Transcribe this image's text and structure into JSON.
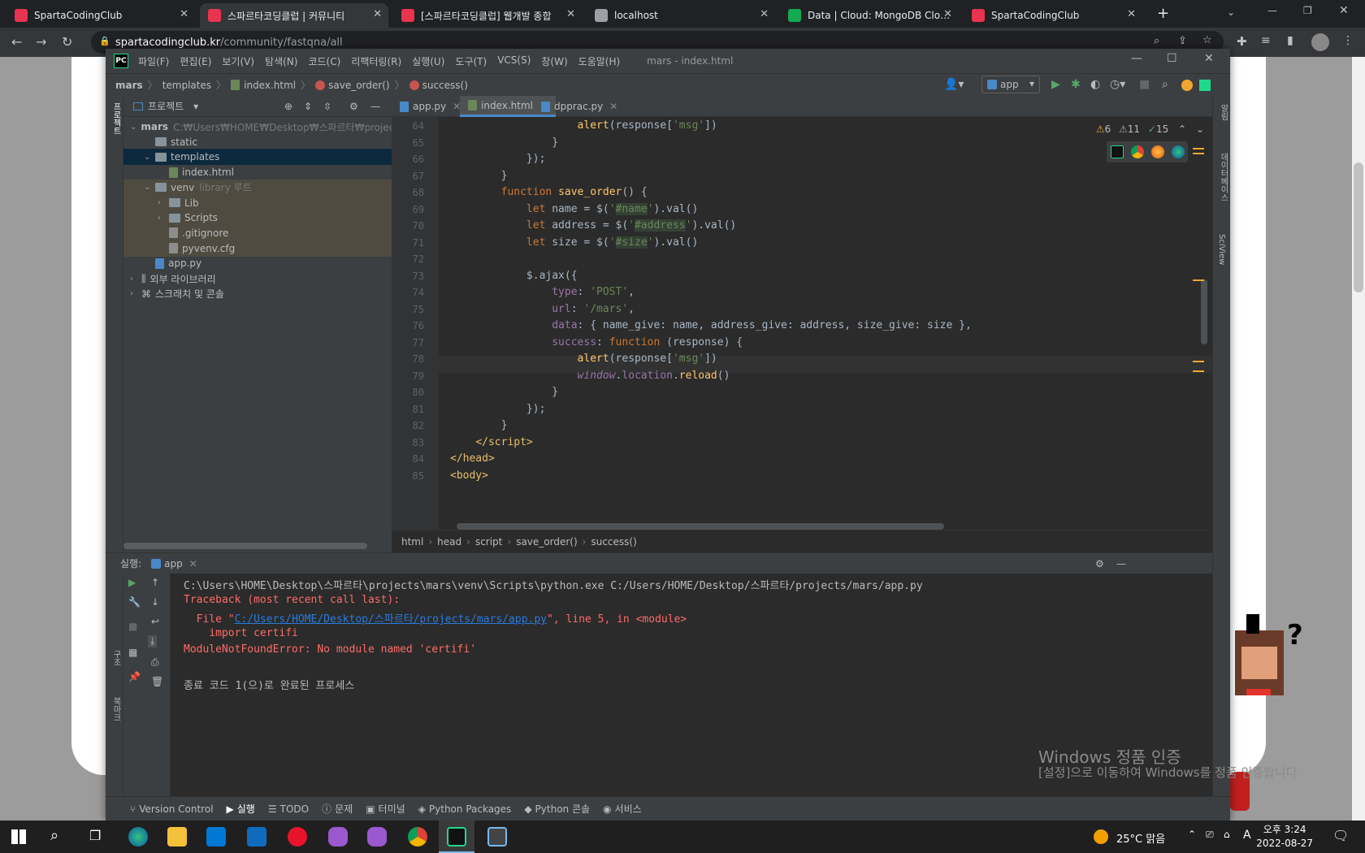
{
  "browser": {
    "tabs": [
      {
        "title": "SpartaCodingClub",
        "icon": "sparta-icon",
        "color": "#e8344e"
      },
      {
        "title": "스파르타코딩클럽 | 커뮤니티",
        "icon": "heart-icon",
        "color": "#e8344e"
      },
      {
        "title": "[스파르타코딩클럽] 웹개발 종합",
        "icon": "question-icon",
        "color": "#e8344e"
      },
      {
        "title": "localhost",
        "icon": "globe-icon",
        "color": "#9aa0a6"
      },
      {
        "title": "Data | Cloud: MongoDB Cloud",
        "icon": "mongodb-leaf-icon",
        "color": "#13aa52"
      },
      {
        "title": "SpartaCodingClub",
        "icon": "sparta-icon",
        "color": "#e8344e"
      }
    ],
    "url_domain": "spartacodingclub.kr",
    "url_path": "/community/fastqna/all"
  },
  "ide": {
    "window_title": "mars - index.html",
    "menus": [
      "파일(F)",
      "편집(E)",
      "보기(V)",
      "탐색(N)",
      "코드(C)",
      "리팩터링(R)",
      "실행(U)",
      "도구(T)",
      "VCS(S)",
      "창(W)",
      "도움말(H)"
    ],
    "breadcrumbs": [
      "mars",
      "templates",
      "index.html",
      "save_order()",
      "success()"
    ],
    "run_config": "app",
    "left_strip_label": "프로젝트",
    "left_strip_bottom": [
      "구조",
      "북마크"
    ],
    "right_strip_labels": [
      "알림",
      "데이터베이스",
      "SciView"
    ],
    "project_panel_title": "프로젝트",
    "tree": [
      {
        "label": "mars",
        "extra": "C:₩Users₩HOME₩Desktop₩스파르타₩projects₩mars",
        "kind": "folder",
        "indent": 0,
        "arrow": "v"
      },
      {
        "label": "static",
        "kind": "folder",
        "indent": 1,
        "arrow": ""
      },
      {
        "label": "templates",
        "kind": "folder",
        "indent": 1,
        "arrow": "v"
      },
      {
        "label": "index.html",
        "kind": "html",
        "indent": 2,
        "arrow": ""
      },
      {
        "label": "venv",
        "extra": "library 루트",
        "kind": "folder",
        "indent": 1,
        "arrow": "v"
      },
      {
        "label": "Lib",
        "kind": "folder",
        "indent": 2,
        "arrow": ">"
      },
      {
        "label": "Scripts",
        "kind": "folder",
        "indent": 2,
        "arrow": ">"
      },
      {
        "label": ".gitignore",
        "kind": "txt",
        "indent": 2,
        "arrow": ""
      },
      {
        "label": "pyvenv.cfg",
        "kind": "txt",
        "indent": 2,
        "arrow": ""
      },
      {
        "label": "app.py",
        "kind": "py",
        "indent": 1,
        "arrow": ""
      },
      {
        "label": "외부 라이브러리",
        "kind": "lib",
        "indent": 0,
        "arrow": ">"
      },
      {
        "label": "스크래치 및 콘솔",
        "kind": "scratch",
        "indent": 0,
        "arrow": ">"
      }
    ],
    "editor_tabs": [
      "app.py",
      "index.html",
      "dpprac.py"
    ],
    "inspections": {
      "warn_a": "6",
      "warn_b": "11",
      "ok": "15"
    },
    "lines": [
      {
        "n": "64",
        "html": "            <span class=\"fn\">alert</span>(response[<span class=\"str\">'msg'</span>])"
      },
      {
        "n": "65",
        "html": "        }"
      },
      {
        "n": "66",
        "html": "    });"
      },
      {
        "n": "67",
        "html": "}"
      },
      {
        "n": "68",
        "html": "<span class=\"kw\">function</span> <span class=\"fn\">save_order</span>() {"
      },
      {
        "n": "69",
        "html": "    <span class=\"kw\">let</span> name = $(<span class=\"str\">'<span class=\"hl\">#name</span>'</span>).val()"
      },
      {
        "n": "70",
        "html": "    <span class=\"kw\">let</span> address = $(<span class=\"str\">'<span class=\"hl\">#address</span>'</span>).val()"
      },
      {
        "n": "71",
        "html": "    <span class=\"kw\">let</span> size = $(<span class=\"str\">'<span class=\"hl\">#size</span>'</span>).val()"
      },
      {
        "n": "72",
        "html": ""
      },
      {
        "n": "73",
        "html": "    $.ajax({"
      },
      {
        "n": "74",
        "html": "        <span class=\"prop\">type</span>: <span class=\"str\">'POST'</span>,"
      },
      {
        "n": "75",
        "html": "        <span class=\"prop\">url</span>: <span class=\"str\">'/mars'</span>,"
      },
      {
        "n": "76",
        "html": "        <span class=\"prop\">data</span>: { name_give: name, address_give: address, size_give: size },"
      },
      {
        "n": "77",
        "html": "        <span class=\"prop\">success</span>: <span class=\"kw\">function</span> (response) {"
      },
      {
        "n": "78",
        "html": "            <span class=\"fn\">alert</span>(response[<span class=\"str\">'msg'</span>])"
      },
      {
        "n": "79",
        "html": "            <span class=\"ital\">window</span>.<span class=\"prop\">location</span>.<span class=\"fn\">reload</span>()"
      },
      {
        "n": "80",
        "html": "        }"
      },
      {
        "n": "81",
        "html": "    });"
      },
      {
        "n": "82",
        "html": "}"
      },
      {
        "n": "83",
        "html": "<span class=\"tag\">&lt;/script&gt;</span>"
      },
      {
        "n": "84",
        "html": "<span class=\"tag\">&lt;/head&gt;</span>"
      },
      {
        "n": "85",
        "html": "<span class=\"tag\">&lt;body&gt;</span>"
      }
    ],
    "editor_crumbs": [
      "html",
      "head",
      "script",
      "save_order()",
      "success()"
    ],
    "run_label": "실행:",
    "run_tab": "app",
    "console": [
      {
        "text": "C:\\Users\\HOME\\Desktop\\스파르타\\projects\\mars\\venv\\Scripts\\python.exe C:/Users/HOME/Desktop/스파르타/projects/mars/app.py",
        "cls": ""
      },
      {
        "text": "Traceback (most recent call last):",
        "cls": "err"
      },
      {
        "text": "  File \"",
        "cls": "err",
        "link": "C:/Users/HOME/Desktop/스파르타/projects/mars/app.py",
        "after": "\", line 5, in <module>"
      },
      {
        "text": "    import certifi",
        "cls": "err"
      },
      {
        "text": "ModuleNotFoundError: No module named 'certifi'",
        "cls": "err"
      },
      {
        "text": "",
        "cls": ""
      },
      {
        "text": "종료 코드 1(으)로 완료된 프로세스",
        "cls": ""
      }
    ],
    "bottom_tabs": [
      "Version Control",
      "실행",
      "TODO",
      "문제",
      "터미널",
      "Python Packages",
      "Python 콘솔",
      "서비스"
    ]
  },
  "watermark": {
    "line1": "Windows 정품 인증",
    "line2": "[설정]으로 이동하여 Windows를 정품 인증합니다."
  },
  "taskbar": {
    "weather": "25°C 맑음",
    "time": "오후 3:24",
    "date": "2022-08-27",
    "ime": "A"
  }
}
